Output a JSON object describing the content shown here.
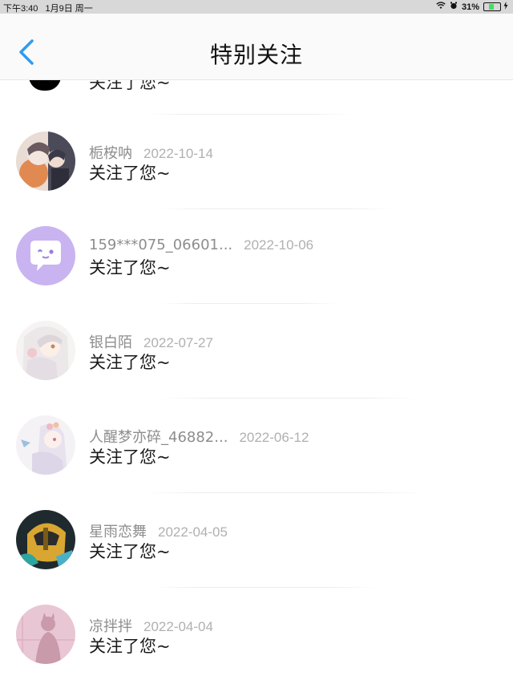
{
  "statusbar": {
    "time": "下午3:40",
    "date": "1月9日 周一",
    "battery": "31%",
    "battery_level": 0.31
  },
  "header": {
    "title": "特别关注"
  },
  "partial_row": {
    "message": "关注了您~"
  },
  "rows": [
    {
      "name": "栀桉呐",
      "date": "2022-10-14",
      "message": "关注了您~",
      "avatar": "anime-girls-hug-avatar"
    },
    {
      "name": "159***075_06601...",
      "date": "2022-10-06",
      "message": "关注了您~",
      "avatar": "purple-chat-bubble-avatar"
    },
    {
      "name": "银白陌",
      "date": "2022-07-27",
      "message": "关注了您~",
      "avatar": "white-hair-anime-avatar"
    },
    {
      "name": "人醒梦亦碎_46882...",
      "date": "2022-06-12",
      "message": "关注了您~",
      "avatar": "anime-girl-bird-avatar"
    },
    {
      "name": "星雨恋舞",
      "date": "2022-04-05",
      "message": "关注了您~",
      "avatar": "robot-helmet-avatar"
    },
    {
      "name": "凉拌拌",
      "date": "2022-04-04",
      "message": "关注了您~",
      "avatar": "pink-silhouette-avatar"
    }
  ],
  "colors": {
    "accent": "#2d9cf0",
    "avatar_purple": "#c9b3f0"
  }
}
